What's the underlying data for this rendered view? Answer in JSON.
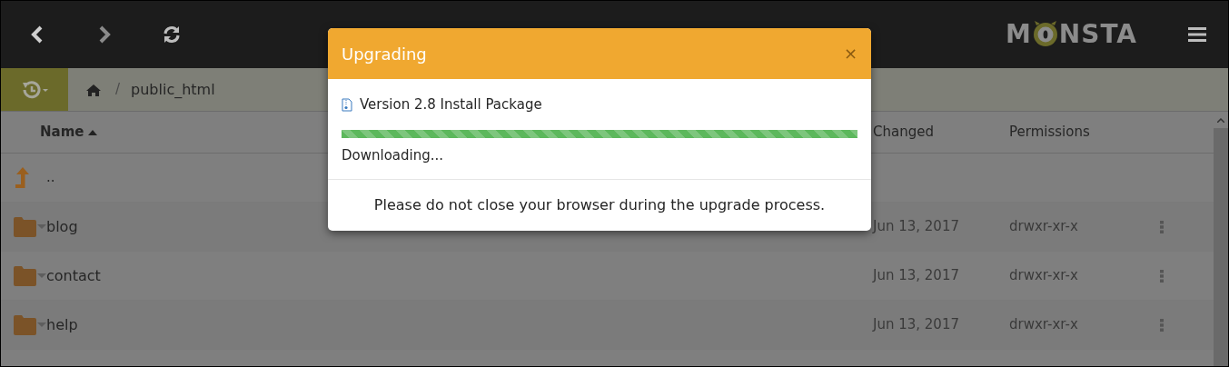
{
  "toolbar": {
    "logo_start": "M",
    "logo_end": "NSTA"
  },
  "breadcrumb": {
    "separator": "/",
    "items": [
      "public_html"
    ]
  },
  "table": {
    "columns": [
      {
        "label": "Name",
        "sorted": true
      },
      {
        "label": "Changed",
        "sorted": false
      },
      {
        "label": "Permissions",
        "sorted": false
      }
    ],
    "rows": [
      {
        "kind": "parent",
        "name": ".."
      },
      {
        "kind": "folder",
        "name": "blog",
        "changed": "Jun 13, 2017",
        "permissions": "drwxr-xr-x"
      },
      {
        "kind": "folder",
        "name": "contact",
        "changed": "Jun 13, 2017",
        "permissions": "drwxr-xr-x"
      },
      {
        "kind": "folder",
        "name": "help",
        "changed": "Jun 13, 2017",
        "permissions": "drwxr-xr-x"
      }
    ]
  },
  "dialog": {
    "title": "Upgrading",
    "close": "×",
    "file": "Version 2.8 Install Package",
    "progress": {
      "level": 1.0
    },
    "status": "Downloading...",
    "message": "Please do not close your browser during the upgrade process."
  }
}
